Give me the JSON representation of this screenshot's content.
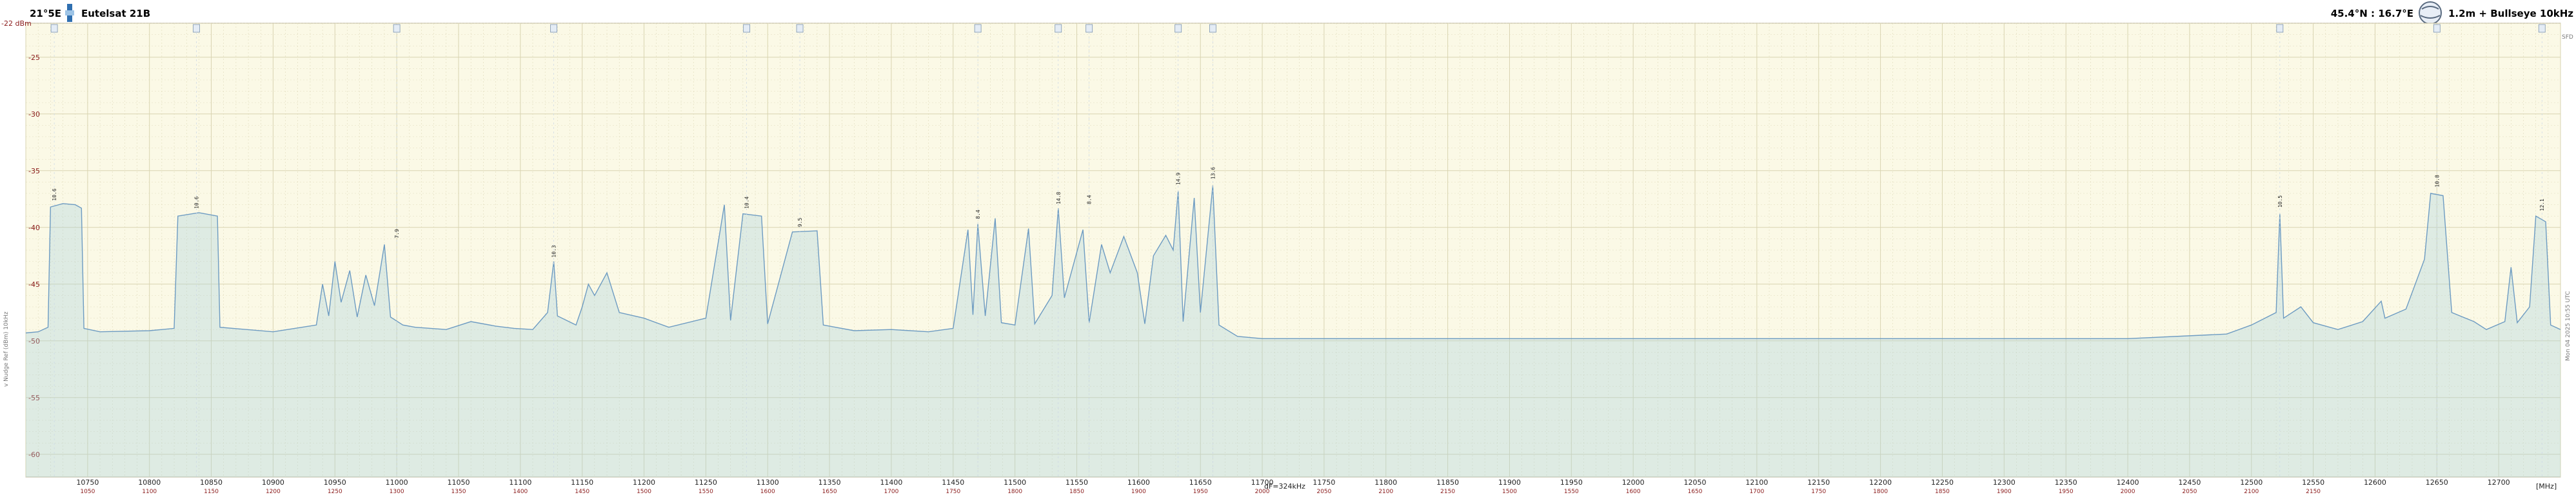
{
  "header": {
    "position": "21°5E",
    "satellite": "Eutelsat 21B",
    "location": "45.4°N : 16.7°E",
    "dish": "1.2m + Bullseye 10kHz"
  },
  "chart_data": {
    "type": "line",
    "title": "",
    "ylabel": "",
    "xlabel": "",
    "unit_y": "dBm",
    "unit_x": "MHz",
    "xlim": [
      10700,
      12750
    ],
    "ylim": [
      -62,
      -22
    ],
    "x_ticks": [
      10750,
      10800,
      10850,
      10900,
      10950,
      11000,
      11050,
      11100,
      11150,
      11200,
      11250,
      11300,
      11350,
      11400,
      11450,
      11500,
      11550,
      11600,
      11650,
      11700,
      11750,
      11800,
      11850,
      11900,
      11950,
      12000,
      12050,
      12100,
      12150,
      12200,
      12250,
      12300,
      12350,
      12400,
      12450,
      12500,
      12550,
      12600,
      12650,
      12700
    ],
    "x_ticks_if": [
      1050,
      1100,
      1150,
      1200,
      1250,
      1300,
      1350,
      1400,
      1450,
      1500,
      1550,
      1600,
      1650,
      1700,
      1750,
      1800,
      1850,
      1900,
      1950,
      2000,
      2050,
      2100,
      2150,
      1500,
      1550,
      1600,
      1650,
      1700,
      1750,
      1800,
      1850,
      1900,
      1950,
      2000,
      2050,
      2100,
      2150
    ],
    "y_ticks": [
      -25,
      -30,
      -35,
      -40,
      -45,
      -50,
      -55,
      -60
    ],
    "y_top_label": "-22 dBm",
    "x_end_label": "[MHz]",
    "marker_label": "dF=324kHz",
    "grid": true,
    "series": [
      {
        "points": [
          [
            10700,
            -49.3
          ],
          [
            10710,
            -49.2
          ],
          [
            10718,
            -48.8
          ],
          [
            10720,
            -38.2
          ],
          [
            10730,
            -37.9
          ],
          [
            10740,
            -38.0
          ],
          [
            10745,
            -38.3
          ],
          [
            10747,
            -48.9
          ],
          [
            10760,
            -49.2
          ],
          [
            10800,
            -49.1
          ],
          [
            10820,
            -48.9
          ],
          [
            10823,
            -39.0
          ],
          [
            10840,
            -38.7
          ],
          [
            10855,
            -39.0
          ],
          [
            10857,
            -48.8
          ],
          [
            10900,
            -49.2
          ],
          [
            10935,
            -48.6
          ],
          [
            10940,
            -45.0
          ],
          [
            10945,
            -47.8
          ],
          [
            10950,
            -43.0
          ],
          [
            10955,
            -46.6
          ],
          [
            10962,
            -43.8
          ],
          [
            10968,
            -47.9
          ],
          [
            10975,
            -44.2
          ],
          [
            10982,
            -46.9
          ],
          [
            10990,
            -41.5
          ],
          [
            10995,
            -47.9
          ],
          [
            11005,
            -48.6
          ],
          [
            11015,
            -48.8
          ],
          [
            11040,
            -49.0
          ],
          [
            11060,
            -48.3
          ],
          [
            11080,
            -48.7
          ],
          [
            11095,
            -48.9
          ],
          [
            11110,
            -49.0
          ],
          [
            11122,
            -47.5
          ],
          [
            11127,
            -43.0
          ],
          [
            11130,
            -47.8
          ],
          [
            11145,
            -48.6
          ],
          [
            11150,
            -47.0
          ],
          [
            11155,
            -45.0
          ],
          [
            11160,
            -46.0
          ],
          [
            11170,
            -44.0
          ],
          [
            11180,
            -47.5
          ],
          [
            11200,
            -48.0
          ],
          [
            11220,
            -48.8
          ],
          [
            11250,
            -48.0
          ],
          [
            11265,
            -38.0
          ],
          [
            11270,
            -48.2
          ],
          [
            11280,
            -38.8
          ],
          [
            11295,
            -39.0
          ],
          [
            11300,
            -48.5
          ],
          [
            11320,
            -40.4
          ],
          [
            11340,
            -40.3
          ],
          [
            11345,
            -48.6
          ],
          [
            11370,
            -49.1
          ],
          [
            11400,
            -49.0
          ],
          [
            11430,
            -49.2
          ],
          [
            11450,
            -48.9
          ],
          [
            11462,
            -40.2
          ],
          [
            11466,
            -47.7
          ],
          [
            11470,
            -39.7
          ],
          [
            11476,
            -47.8
          ],
          [
            11484,
            -39.2
          ],
          [
            11489,
            -48.4
          ],
          [
            11500,
            -48.6
          ],
          [
            11511,
            -40.1
          ],
          [
            11516,
            -48.5
          ],
          [
            11530,
            -46.0
          ],
          [
            11535,
            -38.3
          ],
          [
            11540,
            -46.2
          ],
          [
            11555,
            -40.2
          ],
          [
            11560,
            -48.4
          ],
          [
            11570,
            -41.5
          ],
          [
            11577,
            -44.0
          ],
          [
            11588,
            -40.8
          ],
          [
            11599,
            -44.0
          ],
          [
            11605,
            -48.5
          ],
          [
            11612,
            -42.5
          ],
          [
            11622,
            -40.7
          ],
          [
            11628,
            -42.0
          ],
          [
            11632,
            -36.8
          ],
          [
            11636,
            -48.3
          ],
          [
            11645,
            -37.4
          ],
          [
            11650,
            -47.5
          ],
          [
            11660,
            -36.3
          ],
          [
            11665,
            -48.6
          ],
          [
            11680,
            -49.6
          ],
          [
            11700,
            -49.8
          ],
          [
            11750,
            -49.8
          ],
          [
            11800,
            -49.8
          ],
          [
            11900,
            -49.8
          ],
          [
            12000,
            -49.8
          ],
          [
            12100,
            -49.8
          ],
          [
            12200,
            -49.8
          ],
          [
            12300,
            -49.8
          ],
          [
            12400,
            -49.8
          ],
          [
            12480,
            -49.4
          ],
          [
            12500,
            -48.6
          ],
          [
            12520,
            -47.5
          ],
          [
            12523,
            -38.8
          ],
          [
            12526,
            -48.0
          ],
          [
            12540,
            -47.0
          ],
          [
            12550,
            -48.4
          ],
          [
            12570,
            -49.0
          ],
          [
            12590,
            -48.3
          ],
          [
            12605,
            -46.5
          ],
          [
            12608,
            -48.0
          ],
          [
            12625,
            -47.2
          ],
          [
            12640,
            -42.8
          ],
          [
            12645,
            -37.0
          ],
          [
            12655,
            -37.2
          ],
          [
            12662,
            -47.5
          ],
          [
            12680,
            -48.3
          ],
          [
            12690,
            -49.0
          ],
          [
            12705,
            -48.3
          ],
          [
            12710,
            -43.5
          ],
          [
            12715,
            -48.4
          ],
          [
            12725,
            -47.0
          ],
          [
            12730,
            -39.0
          ],
          [
            12738,
            -39.5
          ],
          [
            12742,
            -48.6
          ],
          [
            12750,
            -49.0
          ]
        ]
      }
    ],
    "peak_labels": [
      {
        "x": 10723,
        "y": -38.0,
        "text": "10.6"
      },
      {
        "x": 10838,
        "y": -38.7,
        "text": "10.6"
      },
      {
        "x": 11000,
        "y": -41.3,
        "text": "7.9"
      },
      {
        "x": 11127,
        "y": -43.0,
        "text": "10.3"
      },
      {
        "x": 11283,
        "y": -38.7,
        "text": "10.4"
      },
      {
        "x": 11326,
        "y": -40.3,
        "text": "9.5"
      },
      {
        "x": 11470,
        "y": -39.6,
        "text": "8.4"
      },
      {
        "x": 11535,
        "y": -38.3,
        "text": "14.8"
      },
      {
        "x": 11560,
        "y": -38.3,
        "text": "8.4"
      },
      {
        "x": 11632,
        "y": -36.6,
        "text": "14.9"
      },
      {
        "x": 11660,
        "y": -36.1,
        "text": "13.6"
      },
      {
        "x": 12523,
        "y": -38.6,
        "text": "10.5"
      },
      {
        "x": 12650,
        "y": -36.8,
        "text": "10.8"
      },
      {
        "x": 12735,
        "y": -38.9,
        "text": "12.1"
      }
    ],
    "channel_markers": [
      "10.6",
      "10.6",
      "7.9",
      "10.3",
      "10.4",
      "9.5",
      "8.4",
      "14.8",
      "8.4",
      "14.9",
      "13.6",
      "10.5",
      "10.8",
      "12.1"
    ]
  },
  "side": {
    "left_vertical": "v Nudge Ref (dBm) 10kHz",
    "right_vertical": "Mon 04 2025 10:55 UTC",
    "right_corner": "SFD"
  },
  "colors": {
    "background": "#fbf9e6",
    "grid": "#d9d4b1",
    "trace": "#6d9bc2",
    "fill": "#a8d0de",
    "axis_text": "#8a1a1a"
  }
}
